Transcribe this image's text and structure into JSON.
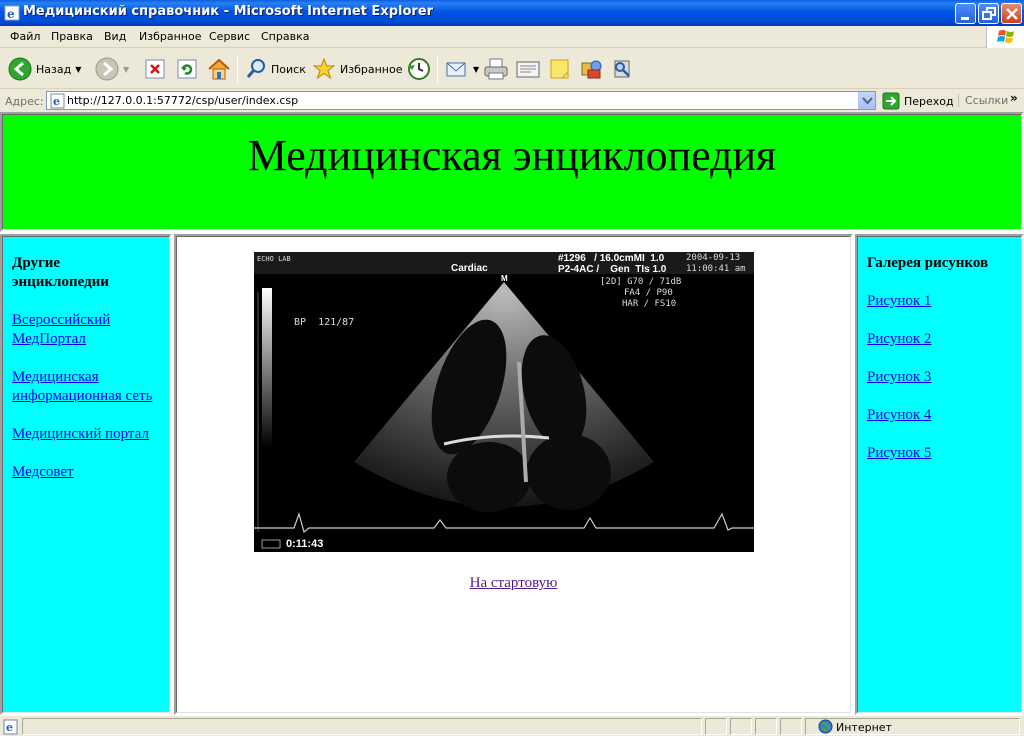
{
  "window": {
    "title": "Медицинский справочник - Microsoft Internet Explorer"
  },
  "menu": [
    "Файл",
    "Правка",
    "Вид",
    "Избранное",
    "Сервис",
    "Справка"
  ],
  "toolbar": {
    "back_label": "Назад",
    "search_label": "Поиск",
    "favorites_label": "Избранное"
  },
  "address": {
    "label": "Адрес:",
    "url": "http://127.0.0.1:57772/csp/user/index.csp",
    "go_label": "Переход",
    "links_label": "Ссылки"
  },
  "page": {
    "header_title": "Медицинская энциклопедия",
    "left": {
      "heading": "Другие энциклопедии",
      "links": [
        "Всероссийский МедПортал",
        "Медицинская информационная сеть",
        "Медицинский портал",
        "Медсовет"
      ]
    },
    "right": {
      "heading": "Галерея рисунков",
      "links": [
        "Рисунок 1",
        "Рисунок 2",
        "Рисунок 3",
        "Рисунок 4",
        "Рисунок 5"
      ]
    },
    "image_overlay": {
      "top_left": "ECHO LAB",
      "mode": "Cardiac",
      "id_line": "#1296   / 16.0cmMI  1.0",
      "date": "2004-09-13",
      "view_line": "P2-4AC /    Gen  TIs 1.0",
      "time": "11:00:41 am",
      "params1": "[2D] G70 / 71dB",
      "params2": "FA4 / P90",
      "params3": "HAR / FS10",
      "bp": "BP  121/87",
      "clip_time": "0:11:43",
      "marker": "M"
    },
    "home_link": "На стартовую"
  },
  "status": {
    "zone": "Интернет"
  },
  "colors": {
    "header_bg": "#00ff00",
    "side_bg": "#00ffff",
    "link": "#0000ee",
    "visited_link": "#551a8b"
  }
}
